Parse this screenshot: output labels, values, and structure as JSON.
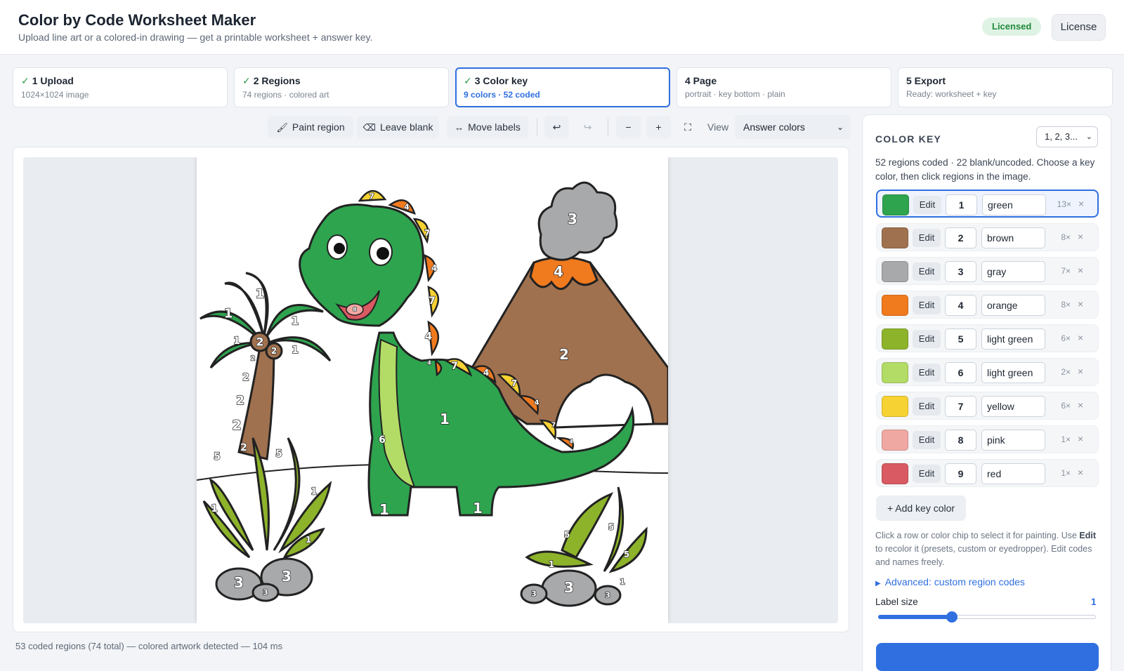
{
  "header": {
    "title": "Color by Code Worksheet Maker",
    "subtitle": "Upload line art or a colored-in drawing — get a printable worksheet + answer key.",
    "badge": "Licensed",
    "license_button": "License"
  },
  "steps": [
    {
      "check": "✓",
      "title": "1 Upload",
      "sub": "1024×1024 image"
    },
    {
      "check": "✓",
      "title": "2 Regions",
      "sub": "74 regions · colored art"
    },
    {
      "check": "✓",
      "title": "3 Color key",
      "sub": "9 colors · 52 coded"
    },
    {
      "check": "",
      "title": "4 Page",
      "sub": "portrait · key bottom · plain"
    },
    {
      "check": "",
      "title": "5 Export",
      "sub": "Ready: worksheet + key"
    }
  ],
  "toolbar": {
    "paint_region": "Paint region",
    "leave_blank": "Leave blank",
    "move_labels": "Move labels",
    "undo": "↩",
    "redo": "↪",
    "zoom_out": "−",
    "zoom_in": "+",
    "fit": "⛶",
    "view_label": "View",
    "view_value": "Answer colors",
    "icons": {
      "paint": "paintbrush-icon",
      "blank": "eraser-icon",
      "move": "arrows-icon"
    }
  },
  "status": "53 coded regions (74 total) — colored artwork detected — 104 ms",
  "color_key": {
    "title": "COLOR KEY",
    "order_value": "1, 2, 3...",
    "description": "52 regions coded · 22 blank/uncoded. Choose a key color, then click regions in the image.",
    "edit_label": "Edit",
    "delete_label": "×",
    "rows": [
      {
        "color": "#2ea44f",
        "code": "1",
        "name": "green",
        "count": "13×",
        "selected": true
      },
      {
        "color": "#a0714f",
        "code": "2",
        "name": "brown",
        "count": "8×"
      },
      {
        "color": "#a8a9ab",
        "code": "3",
        "name": "gray",
        "count": "7×"
      },
      {
        "color": "#f07a1e",
        "code": "4",
        "name": "orange",
        "count": "8×"
      },
      {
        "color": "#8db32b",
        "code": "5",
        "name": "light green",
        "count": "6×"
      },
      {
        "color": "#b3dc66",
        "code": "6",
        "name": "light green",
        "count": "2×"
      },
      {
        "color": "#f7d233",
        "code": "7",
        "name": "yellow",
        "count": "6×"
      },
      {
        "color": "#f0a8a3",
        "code": "8",
        "name": "pink",
        "count": "1×"
      },
      {
        "color": "#d95a62",
        "code": "9",
        "name": "red",
        "count": "1×"
      }
    ],
    "add_button": "+ Add key color",
    "help_part1": "Click a row or color chip to select it for painting. Use ",
    "help_bold": "Edit",
    "help_part2": " to recolor it (presets, custom or eyedropper). Edit codes and names freely.",
    "advanced": "Advanced: custom region codes",
    "label_size_label": "Label size",
    "label_size_value": "1",
    "label_size_level": 0.34
  },
  "art_labels": {
    "palm_leaves": [
      "1",
      "1",
      "1",
      "1",
      "1",
      "1"
    ],
    "trunk": [
      "2",
      "2",
      "2",
      "2",
      "2",
      "2",
      "2",
      "2"
    ],
    "dino_body": "1",
    "dino_belly": "6",
    "dino_leg1": "1",
    "dino_leg2": "1",
    "spikes": [
      "7",
      "4",
      "7",
      "4",
      "7",
      "4",
      "7",
      "4",
      "7",
      "4",
      "7",
      "4",
      "7",
      "4"
    ],
    "volcano": "2",
    "lava": "4",
    "smoke": "3",
    "tongue": "8",
    "rocks": [
      "3",
      "3",
      "3",
      "3",
      "3",
      "3"
    ],
    "plants": [
      "5",
      "5",
      "1",
      "1",
      "1",
      "5",
      "5",
      "5",
      "5",
      "1",
      "1"
    ]
  }
}
